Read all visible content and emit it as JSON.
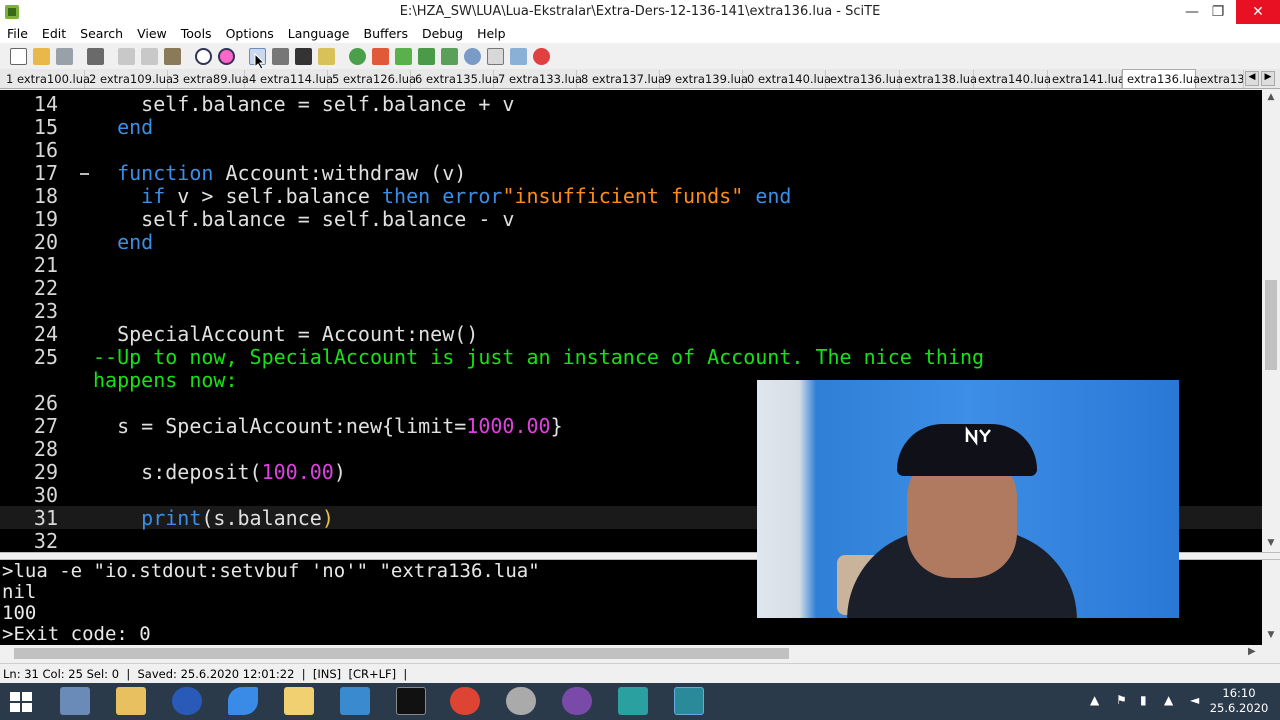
{
  "window": {
    "title": "E:\\HZA_SW\\LUA\\Lua-Ekstralar\\Extra-Ders-12-136-141\\extra136.lua - SciTE"
  },
  "menu": [
    "File",
    "Edit",
    "Search",
    "View",
    "Tools",
    "Options",
    "Language",
    "Buffers",
    "Debug",
    "Help"
  ],
  "tabs": [
    {
      "label": "1 extra100.lua"
    },
    {
      "label": "2 extra109.lua"
    },
    {
      "label": "3 extra89.lua"
    },
    {
      "label": "4 extra114.lua"
    },
    {
      "label": "5 extra126.lua"
    },
    {
      "label": "6 extra135.lua"
    },
    {
      "label": "7 extra133.lua"
    },
    {
      "label": "8 extra137.lua"
    },
    {
      "label": "9 extra139.lua"
    },
    {
      "label": "0 extra140.lua"
    },
    {
      "label": "extra136.lua"
    },
    {
      "label": "extra138.lua"
    },
    {
      "label": "extra140.lua"
    },
    {
      "label": "extra141.lua"
    },
    {
      "label": "extra136.lua",
      "active": true
    },
    {
      "label": "extra13"
    }
  ],
  "editor": {
    "lines": [
      {
        "n": "14",
        "tokens": [
          [
            "    self.balance = self.balance + v",
            ""
          ]
        ]
      },
      {
        "n": "15",
        "tokens": [
          [
            "  end",
            "kw"
          ]
        ]
      },
      {
        "n": "16",
        "tokens": []
      },
      {
        "n": "17",
        "tokens": [
          [
            "  function",
            "kw"
          ],
          [
            " Account:withdraw (v)",
            ""
          ]
        ]
      },
      {
        "n": "18",
        "tokens": [
          [
            "    if",
            "kw"
          ],
          [
            " v > self.balance ",
            ""
          ],
          [
            "then",
            "kw"
          ],
          [
            " ",
            ""
          ],
          [
            "error",
            "kw"
          ],
          [
            "\"insufficient funds\"",
            "str"
          ],
          [
            " ",
            ""
          ],
          [
            "end",
            "kw"
          ]
        ]
      },
      {
        "n": "19",
        "tokens": [
          [
            "    self.balance = self.balance - v",
            ""
          ]
        ]
      },
      {
        "n": "20",
        "tokens": [
          [
            "  end",
            "kw"
          ]
        ]
      },
      {
        "n": "21",
        "tokens": []
      },
      {
        "n": "22",
        "tokens": []
      },
      {
        "n": "23",
        "tokens": []
      },
      {
        "n": "24",
        "tokens": [
          [
            "  SpecialAccount = Account:new()",
            ""
          ]
        ]
      },
      {
        "n": "25",
        "tokens": [
          [
            "--Up to now, SpecialAccount is just an instance of Account. The nice thing",
            "cmt"
          ]
        ]
      },
      {
        "n": "",
        "tokens": [
          [
            "happens now:",
            "cmt"
          ]
        ]
      },
      {
        "n": "26",
        "tokens": []
      },
      {
        "n": "27",
        "tokens": [
          [
            "  s = SpecialAccount:new{limit=",
            ""
          ],
          [
            "1000.00",
            "num"
          ],
          [
            "}",
            ""
          ]
        ]
      },
      {
        "n": "28",
        "tokens": []
      },
      {
        "n": "29",
        "tokens": [
          [
            "    s:deposit(",
            ""
          ],
          [
            "100.00",
            "num"
          ],
          [
            ")",
            ""
          ]
        ]
      },
      {
        "n": "30",
        "tokens": []
      },
      {
        "n": "31",
        "tokens": [
          [
            "    ",
            ""
          ],
          [
            "print",
            "kw"
          ],
          [
            "(s.balance",
            ""
          ],
          [
            ")",
            "gold"
          ]
        ],
        "current": true
      },
      {
        "n": "32",
        "tokens": []
      }
    ]
  },
  "output": [
    ">lua -e \"io.stdout:setvbuf 'no'\" \"extra136.lua\"",
    "nil",
    "100",
    ">Exit code: 0"
  ],
  "status": "Ln: 31 Col: 25 Sel: 0  |  Saved: 25.6.2020 12:01:22  |  [INS]  [CR+LF]  |",
  "clock": {
    "time": "16:10",
    "date": "25.6.2020"
  },
  "colors": {
    "keyword": "#3a8ee6",
    "string": "#ff8c1a",
    "number": "#e040e0",
    "comment": "#16e116",
    "close_button": "#e81123"
  },
  "icons": [
    "scite-app-icon",
    "new-file-icon",
    "open-folder-icon",
    "save-icon",
    "print-icon",
    "cut-icon",
    "copy-icon",
    "paste-icon",
    "find-icon",
    "replace-icon",
    "compile-icon",
    "stop-icon",
    "go-icon"
  ]
}
